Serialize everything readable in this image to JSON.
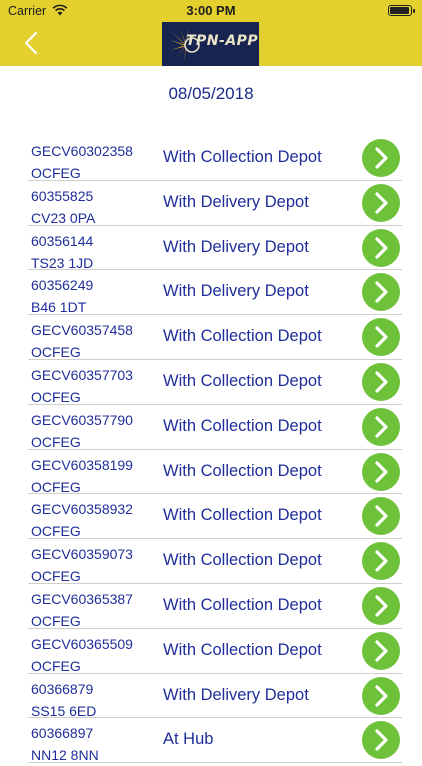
{
  "status_bar": {
    "carrier": "Carrier",
    "time": "3:00 PM",
    "battery_level_percent": 100
  },
  "header": {
    "logo_text": "TPN-APP",
    "background_color": "#e3cf2e",
    "logo_color": "#16244f"
  },
  "date": "08/05/2018",
  "accent_color": "#6dc23a",
  "rows": [
    {
      "ref1": "GECV60302358",
      "ref2": "OCFEG",
      "status": "With Collection Depot"
    },
    {
      "ref1": "60355825",
      "ref2": "CV23 0PA",
      "status": "With Delivery Depot"
    },
    {
      "ref1": "60356144",
      "ref2": "TS23 1JD",
      "status": "With Delivery Depot"
    },
    {
      "ref1": "60356249",
      "ref2": "B46 1DT",
      "status": "With Delivery Depot"
    },
    {
      "ref1": "GECV60357458",
      "ref2": "OCFEG",
      "status": "With Collection Depot"
    },
    {
      "ref1": "GECV60357703",
      "ref2": "OCFEG",
      "status": "With Collection Depot"
    },
    {
      "ref1": "GECV60357790",
      "ref2": "OCFEG",
      "status": "With Collection Depot"
    },
    {
      "ref1": "GECV60358199",
      "ref2": "OCFEG",
      "status": "With Collection Depot"
    },
    {
      "ref1": "GECV60358932",
      "ref2": "OCFEG",
      "status": "With Collection Depot"
    },
    {
      "ref1": "GECV60359073",
      "ref2": "OCFEG",
      "status": "With Collection Depot"
    },
    {
      "ref1": "GECV60365387",
      "ref2": "OCFEG",
      "status": "With Collection Depot"
    },
    {
      "ref1": "GECV60365509",
      "ref2": "OCFEG",
      "status": "With Collection Depot"
    },
    {
      "ref1": "60366879",
      "ref2": "SS15 6ED",
      "status": "With Delivery Depot"
    },
    {
      "ref1": "60366897",
      "ref2": "NN12 8NN",
      "status": "At Hub"
    }
  ]
}
